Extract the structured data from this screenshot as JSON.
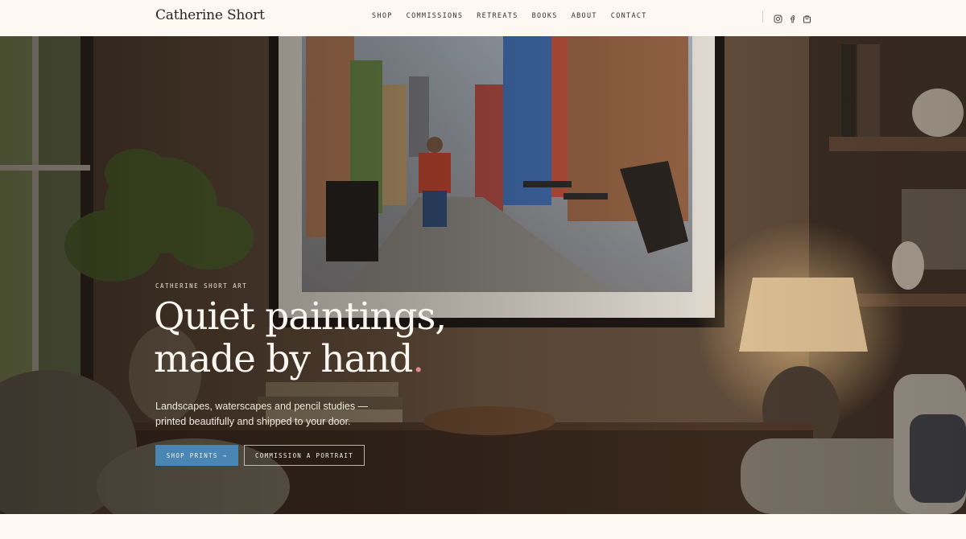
{
  "header": {
    "brand": "Catherine Short",
    "nav": [
      "SHOP",
      "COMMISSIONS",
      "RETREATS",
      "BOOKS",
      "ABOUT",
      "CONTACT"
    ],
    "icons": [
      "instagram-icon",
      "facebook-icon",
      "shopping-bag-icon"
    ]
  },
  "hero": {
    "eyebrow": "CATHERINE SHORT ART",
    "headline_line1": "Quiet paintings,",
    "headline_line2": "made by hand",
    "headline_dot": ".",
    "lede_line1": "Landscapes, waterscapes and pencil studies —",
    "lede_line2": "printed beautifully and shipped to your door.",
    "primary_cta": "SHOP PRINTS →",
    "secondary_cta": "COMMISSION A PORTRAIT"
  },
  "colors": {
    "background": "#fdf8f1",
    "accent_blue": "#4a86b3",
    "accent_dot": "#e08a8f",
    "text_dark": "#2b2420"
  }
}
